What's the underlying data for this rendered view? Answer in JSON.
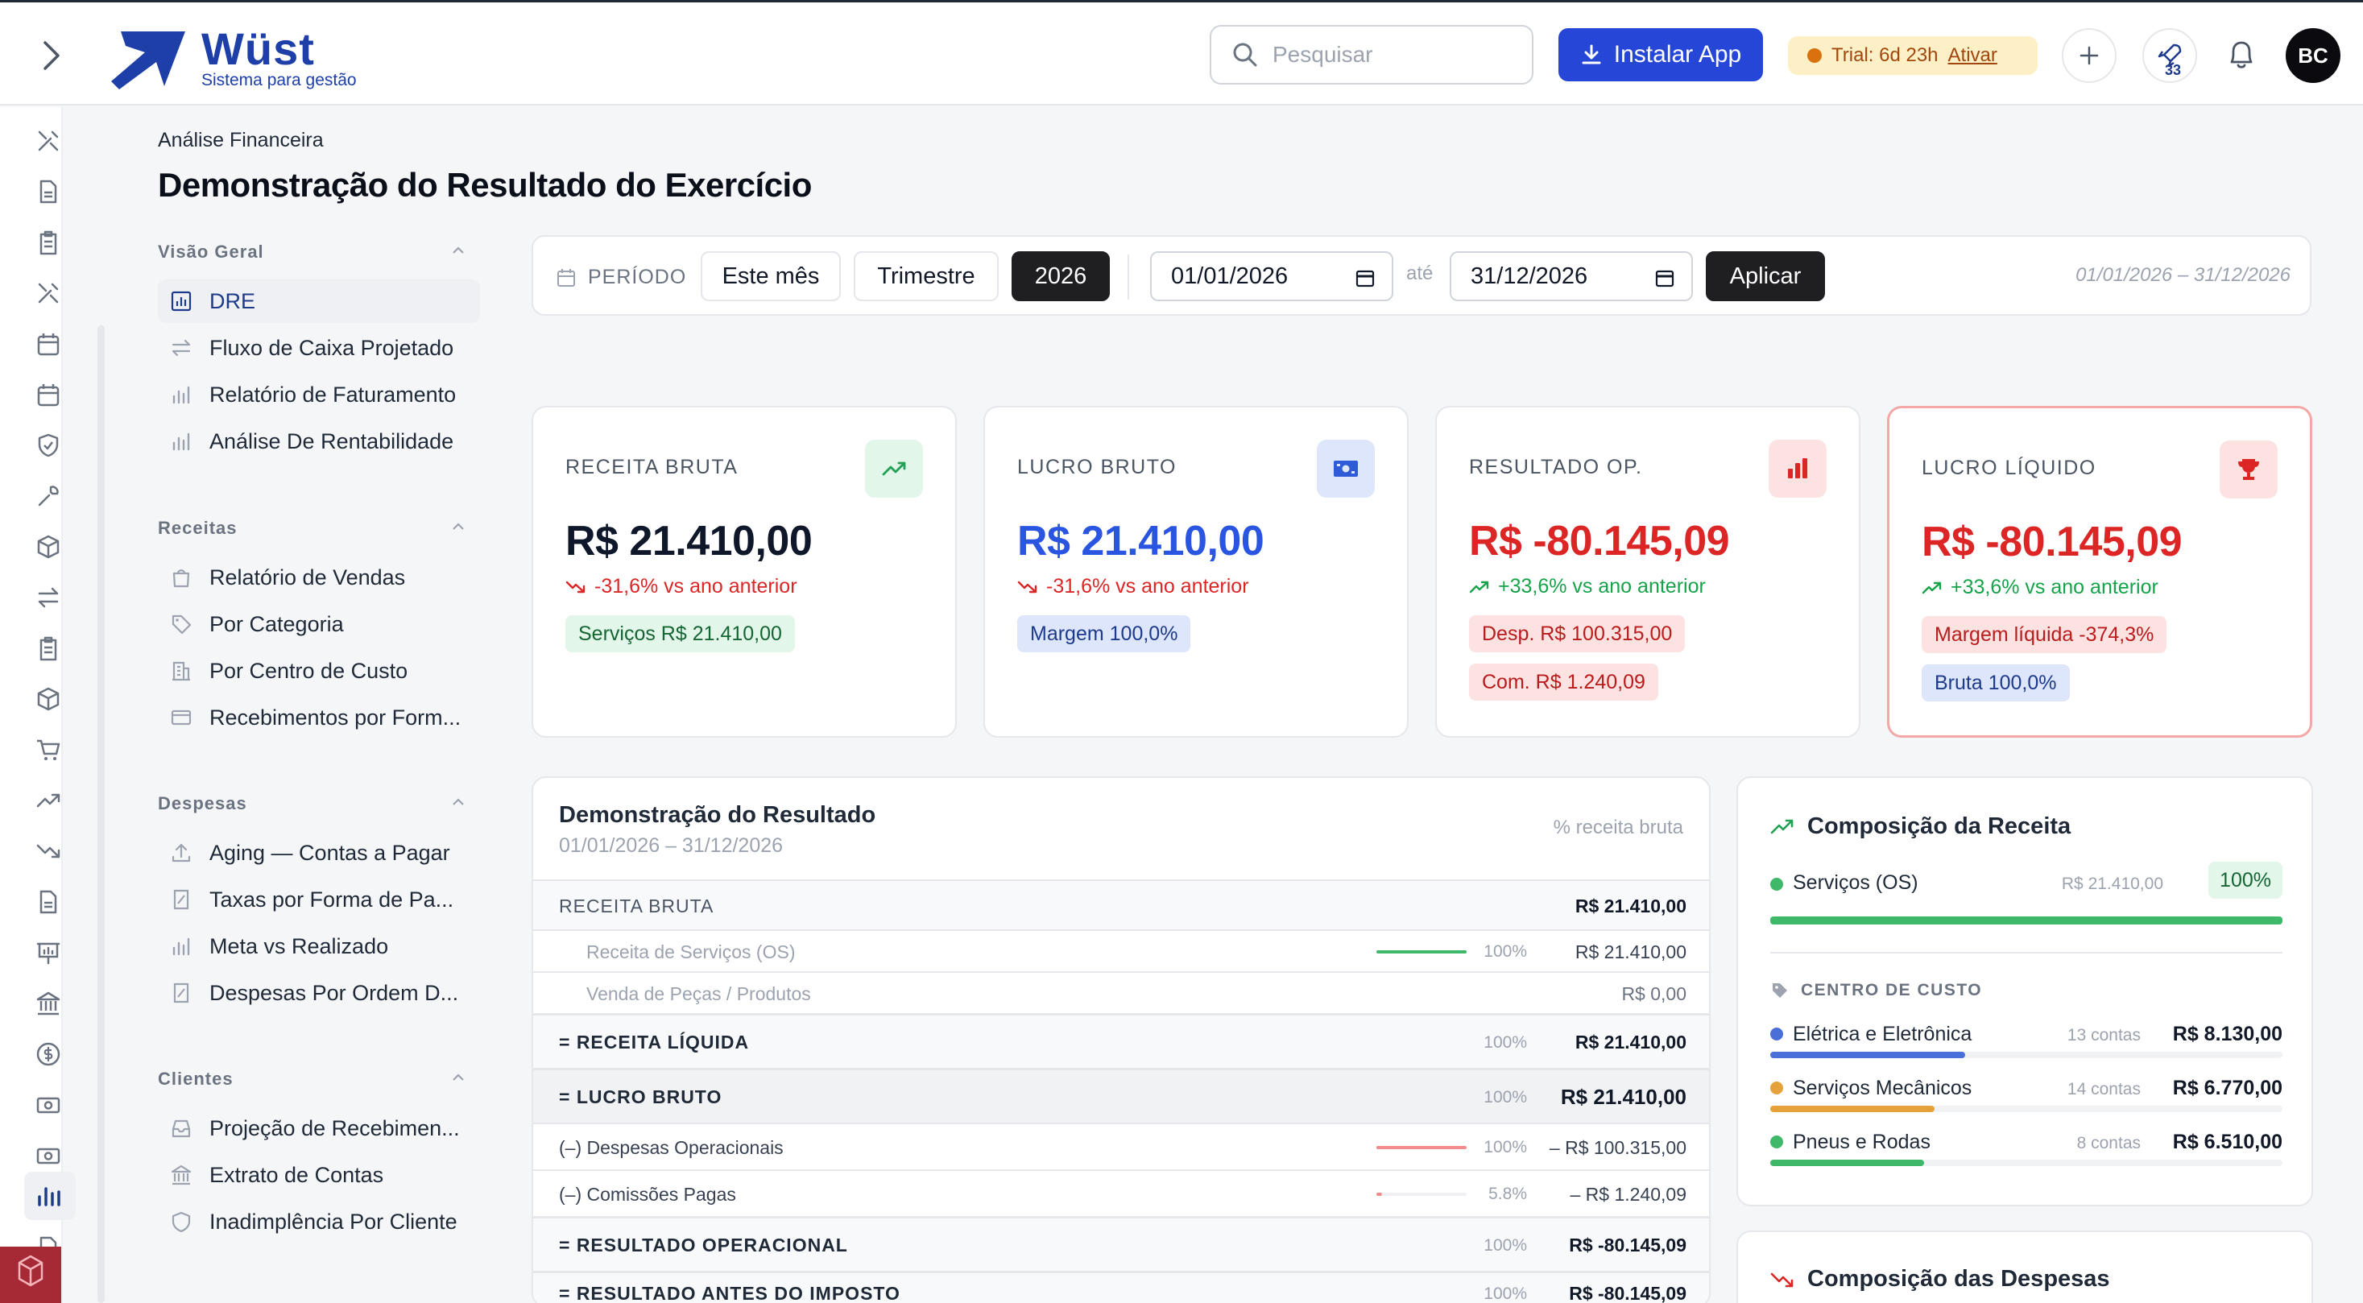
{
  "app": {
    "logo_name": "Wüst",
    "logo_tagline": "Sistema para gestão",
    "search_placeholder": "Pesquisar",
    "install_label": "Instalar App",
    "trial_text": "Trial: 6d 23h",
    "trial_action": "Ativar",
    "rocket_count": "33",
    "avatar_initials": "BC"
  },
  "page": {
    "breadcrumb": "Análise Financeira",
    "title": "Demonstração do Resultado do Exercício"
  },
  "subnav": {
    "groups": [
      {
        "label": "Visão Geral",
        "items": [
          "DRE",
          "Fluxo de Caixa Projetado",
          "Relatório de Faturamento",
          "Análise De Rentabilidade"
        ]
      },
      {
        "label": "Receitas",
        "items": [
          "Relatório de Vendas",
          "Por Categoria",
          "Por Centro de Custo",
          "Recebimentos por Form..."
        ]
      },
      {
        "label": "Despesas",
        "items": [
          "Aging — Contas a Pagar",
          "Taxas por Forma de Pa...",
          "Meta vs Realizado",
          "Despesas Por Ordem D..."
        ]
      },
      {
        "label": "Clientes",
        "items": [
          "Projeção de Recebimen...",
          "Extrato de Contas",
          "Inadimplência Por Cliente"
        ]
      }
    ]
  },
  "period": {
    "label": "PERÍODO",
    "btn_month": "Este mês",
    "btn_quarter": "Trimestre",
    "btn_year": "2026",
    "date_from": "01/01/2026",
    "until": "até",
    "date_to": "31/12/2026",
    "apply": "Aplicar",
    "range_display": "01/01/2026 – 31/12/2026"
  },
  "kpis": [
    {
      "label": "RECEITA BRUTA",
      "value": "R$ 21.410,00",
      "change": "-31,6% vs ano anterior",
      "pills": [
        "Serviços R$ 21.410,00"
      ]
    },
    {
      "label": "LUCRO BRUTO",
      "value": "R$ 21.410,00",
      "change": "-31,6% vs ano anterior",
      "pills": [
        "Margem 100,0%"
      ]
    },
    {
      "label": "RESULTADO OP.",
      "value": "R$ -80.145,09",
      "change": "+33,6% vs ano anterior",
      "pills": [
        "Desp. R$ 100.315,00",
        "Com. R$ 1.240,09"
      ]
    },
    {
      "label": "LUCRO LÍQUIDO",
      "value": "R$ -80.145,09",
      "change": "+33,6% vs ano anterior",
      "pills": [
        "Margem líquida -374,3%",
        "Bruta 100,0%"
      ]
    }
  ],
  "dre": {
    "title": "Demonstração do Resultado",
    "subtitle": "01/01/2026 – 31/12/2026",
    "pct_header": "% receita bruta",
    "rows": [
      {
        "label": "RECEITA BRUTA",
        "pct": "",
        "value": "R$ 21.410,00",
        "bar": 0
      },
      {
        "label": "Receita de Serviços (OS)",
        "pct": "100%",
        "value": "R$ 21.410,00",
        "bar": 1.0
      },
      {
        "label": "Venda de Peças / Produtos",
        "pct": "",
        "value": "R$ 0,00",
        "bar": 0
      },
      {
        "label": "= RECEITA LÍQUIDA",
        "pct": "100%",
        "value": "R$ 21.410,00",
        "bar": 0
      },
      {
        "label": "= LUCRO BRUTO",
        "pct": "100%",
        "value": "R$ 21.410,00",
        "bar": 0
      },
      {
        "label": "(–) Despesas Operacionais",
        "pct": "100%",
        "value": "– R$ 100.315,00",
        "bar": 1.0
      },
      {
        "label": "(–) Comissões Pagas",
        "pct": "5.8%",
        "value": "– R$ 1.240,09",
        "bar": 0.058
      },
      {
        "label": "= RESULTADO OPERACIONAL",
        "pct": "100%",
        "value": "R$ -80.145,09",
        "bar": 0
      },
      {
        "label": "= RESULTADO ANTES DO IMPOSTO",
        "pct": "100%",
        "value": "R$ -80.145,09",
        "bar": 0
      }
    ]
  },
  "composition": {
    "title": "Composição da Receita",
    "revenue": {
      "name": "Serviços (OS)",
      "amount": "R$ 21.410,00",
      "share": "100%",
      "fraction": 1.0
    },
    "cost_center_label": "CENTRO DE CUSTO",
    "cost_centers": [
      {
        "name": "Elétrica e Eletrônica",
        "count": "13 contas",
        "amount": "R$ 8.130,00",
        "fraction": 0.38,
        "color": "#4a6fd8"
      },
      {
        "name": "Serviços Mecânicos",
        "count": "14 contas",
        "amount": "R$ 6.770,00",
        "fraction": 0.32,
        "color": "#e5a23a"
      },
      {
        "name": "Pneus e Rodas",
        "count": "8 contas",
        "amount": "R$ 6.510,00",
        "fraction": 0.3,
        "color": "#3fb86a"
      }
    ],
    "expenses_title": "Composição das Despesas"
  },
  "colors": {
    "accent": "#2546d6",
    "negative": "#dc2626",
    "positive": "#16a34a",
    "brand": "#1e3fa8"
  }
}
